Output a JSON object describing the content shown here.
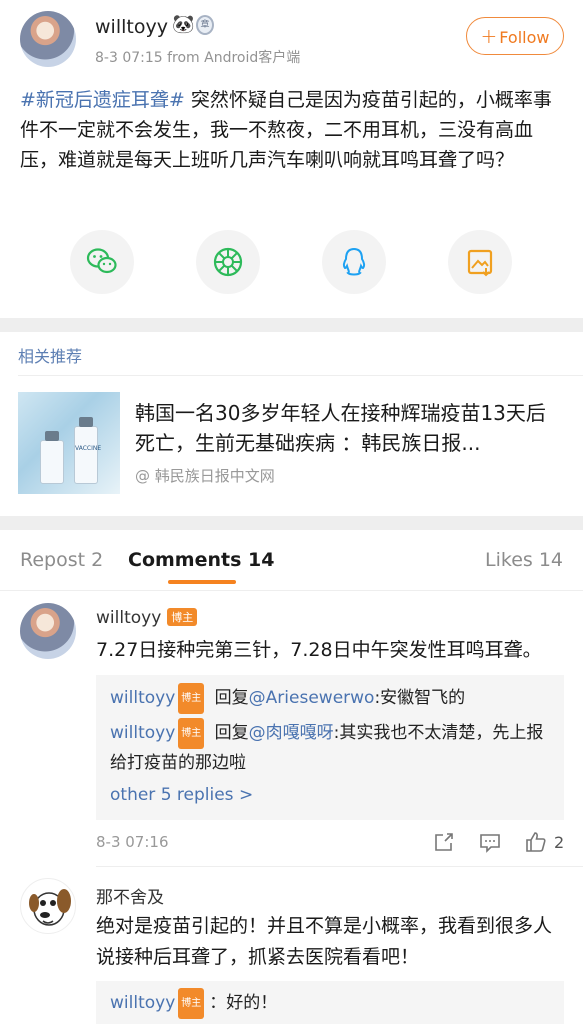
{
  "post": {
    "username": "willtoyy",
    "badge_panda": "🐼",
    "badge_medal": "章",
    "time_source": "8-3 07:15  from Android客户端",
    "follow_label": "Follow",
    "follow_plus": "+",
    "hashtag": "#新冠后遗症耳聋#",
    "text": " 突然怀疑自己是因为疫苗引起的，小概率事件不一定就不会发生，我一不熬夜，二不用耳机，三没有高血压，难道就是每天上班听几声汽车喇叭响就耳鸣耳聋了吗？"
  },
  "share": [
    {
      "icon": "wechat-icon",
      "color": "#2dba5a"
    },
    {
      "icon": "moments-icon",
      "color": "#2dba5a"
    },
    {
      "icon": "qq-icon",
      "color": "#1da1f2"
    },
    {
      "icon": "save-image-icon",
      "color": "#f0a020"
    }
  ],
  "related": {
    "title": "相关推荐",
    "headline": "韩国一名30多岁年轻人在接种辉瑞疫苗13天后死亡，生前无基础疾病 ：韩民族日报...",
    "source": "@ 韩民族日报中文网",
    "thumb_label": "VACCINE"
  },
  "tabs": {
    "repost": "Repost 2",
    "comments": "Comments 14",
    "likes": "Likes 14"
  },
  "comments": [
    {
      "name": "willtoyy",
      "badge": "博主",
      "text": "7.27日接种完第三针，7.28日中午突发性耳鸣耳聋。",
      "replies": [
        {
          "user": "willtoyy",
          "badge": "博主",
          "prefix": " 回复",
          "at": "@Ariesewerwo",
          "text": ":安徽智飞的"
        },
        {
          "user": "willtoyy",
          "badge": "博主",
          "prefix": " 回复",
          "at": "@肉嘎嘎呀",
          "text": ":其实我也不太清楚，先上报给打疫苗的那边啦"
        }
      ],
      "more": "other 5 replies >",
      "time": "8-3 07:16",
      "likes": "2"
    },
    {
      "name": "那不舍及",
      "text": "绝对是疫苗引起的！并且不算是小概率，我看到很多人说接种后耳聋了，抓紧去医院看看吧！",
      "replies": [
        {
          "user": "willtoyy",
          "badge": "博主",
          "text": "：好的！"
        }
      ]
    }
  ],
  "colors": {
    "accent": "#f5821f",
    "link": "#4a73b0",
    "muted": "#999999"
  }
}
